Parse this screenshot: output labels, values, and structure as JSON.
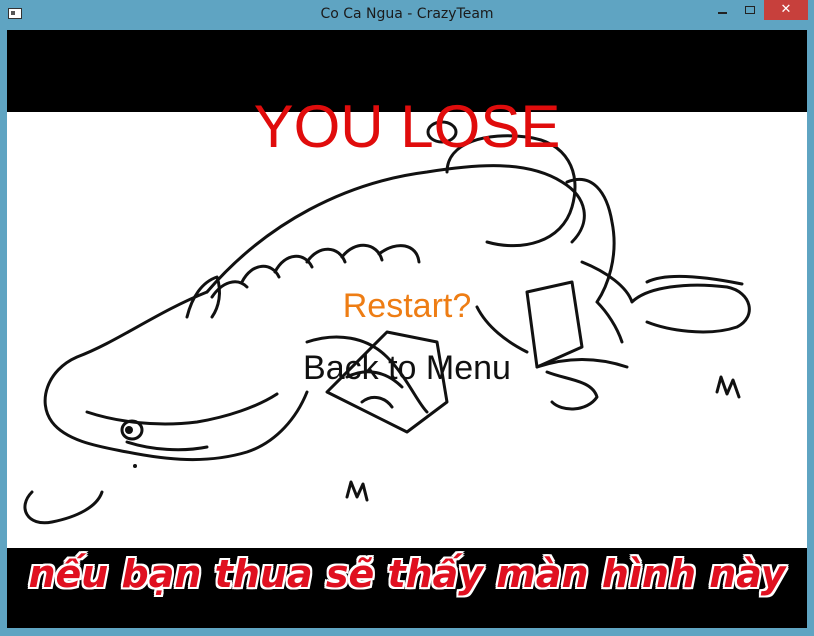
{
  "window": {
    "title": "Co Ca Ngua - CrazyTeam",
    "close_symbol": "✕"
  },
  "game": {
    "headline": "YOU LOSE",
    "menu": {
      "restart_label": "Restart?",
      "back_label": "Back to Menu"
    },
    "illustration": "collapsed-horse-cartoon"
  },
  "caption": "nếu bạn thua sẽ thấy màn hình này",
  "colors": {
    "headline": "#e00c0c",
    "restart": "#ee7d14",
    "menu_text": "#111111",
    "caption": "#e01020",
    "frame": "#5fa4c2"
  }
}
